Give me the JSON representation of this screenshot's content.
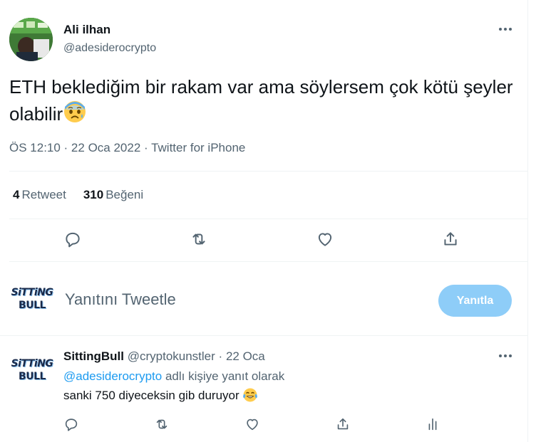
{
  "tweet": {
    "author_name": "Ali ilhan",
    "author_handle": "@adesiderocrypto",
    "text": "ETH beklediğim bir rakam var ama söylersem çok kötü şeyler olabilir",
    "emoji_icon": "anxious-face-emoji-icon",
    "timestamp": "ÖS 12:10 · 22 Oca 2022 · Twitter for iPhone",
    "retweet_count": "4",
    "retweet_label": "Retweet",
    "like_count": "310",
    "like_label": "Beğeni"
  },
  "compose": {
    "placeholder": "Yanıtını Tweetle",
    "button_label": "Yanıtla",
    "avatar_line1": "SiTTiNG",
    "avatar_line2": "BULL"
  },
  "reply": {
    "author_name": "SittingBull",
    "author_handle": "@cryptokunstler",
    "separator": "·",
    "date": "22 Oca",
    "mention": "@adesiderocrypto",
    "replying_to_suffix": "adlı kişiye yanıt olarak",
    "text": "sanki 750 diyeceksin gib duruyor",
    "emoji_icon": "tears-of-joy-emoji-icon",
    "avatar_line1": "SiTTiNG",
    "avatar_line2": "BULL"
  },
  "colors": {
    "accent": "#1d9bf0",
    "reply_button_disabled": "#8ecdf8",
    "secondary_text": "#536471",
    "divider": "#eff3f4"
  }
}
